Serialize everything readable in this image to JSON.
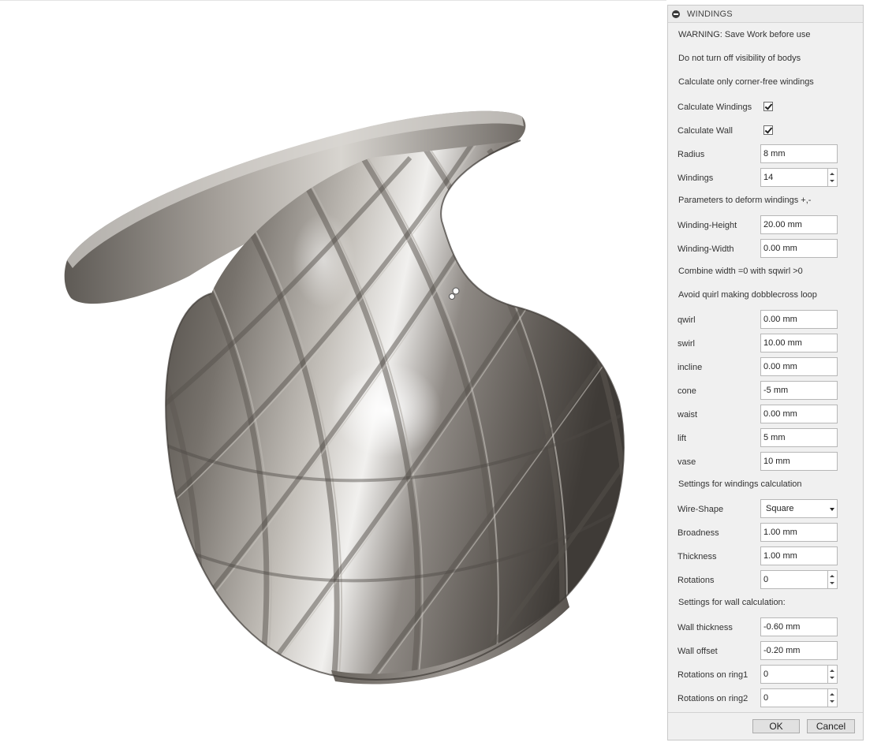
{
  "panel": {
    "title": "WINDINGS",
    "notes": {
      "warning": "WARNING: Save Work before use",
      "visibility": "Do not turn off visibility of bodys",
      "corner_free": "Calculate only corner-free windings",
      "deform": "Parameters to deform windings +,-",
      "combine": "Combine width =0 with sqwirl >0",
      "avoid": "Avoid quirl making dobblecross loop",
      "settings_windings": "Settings for windings calculation",
      "settings_wall": "Settings for wall calculation:"
    },
    "calc_windings": {
      "label": "Calculate Windings",
      "checked": true
    },
    "calc_wall": {
      "label": "Calculate Wall",
      "checked": true
    },
    "radius": {
      "label": "Radius",
      "value": "8 mm"
    },
    "windings": {
      "label": "Windings",
      "value": "14"
    },
    "winding_height": {
      "label": "Winding-Height",
      "value": "20.00 mm"
    },
    "winding_width": {
      "label": "Winding-Width",
      "value": "0.00 mm"
    },
    "qwirl": {
      "label": "qwirl",
      "value": "0.00 mm"
    },
    "swirl": {
      "label": "swirl",
      "value": "10.00 mm"
    },
    "incline": {
      "label": "incline",
      "value": "0.00 mm"
    },
    "cone": {
      "label": "cone",
      "value": "-5 mm"
    },
    "waist": {
      "label": "waist",
      "value": "0.00 mm"
    },
    "lift": {
      "label": "lift",
      "value": "5 mm"
    },
    "vase": {
      "label": "vase",
      "value": "10 mm"
    },
    "wire_shape": {
      "label": "Wire-Shape",
      "value": "Square"
    },
    "broadness": {
      "label": "Broadness",
      "value": "1.00 mm"
    },
    "thickness": {
      "label": "Thickness",
      "value": "1.00 mm"
    },
    "rotations": {
      "label": "Rotations",
      "value": "0"
    },
    "wall_thickness": {
      "label": "Wall thickness",
      "value": "-0.60 mm"
    },
    "wall_offset": {
      "label": "Wall offset",
      "value": "-0.20 mm"
    },
    "rotations_ring1": {
      "label": "Rotations on ring1",
      "value": "0"
    },
    "rotations_ring2": {
      "label": "Rotations on ring2",
      "value": "0"
    },
    "ok_label": "OK",
    "cancel_label": "Cancel"
  },
  "colors": {
    "panel_bg": "#f0f0f0",
    "model_metal": "#8c8781"
  }
}
